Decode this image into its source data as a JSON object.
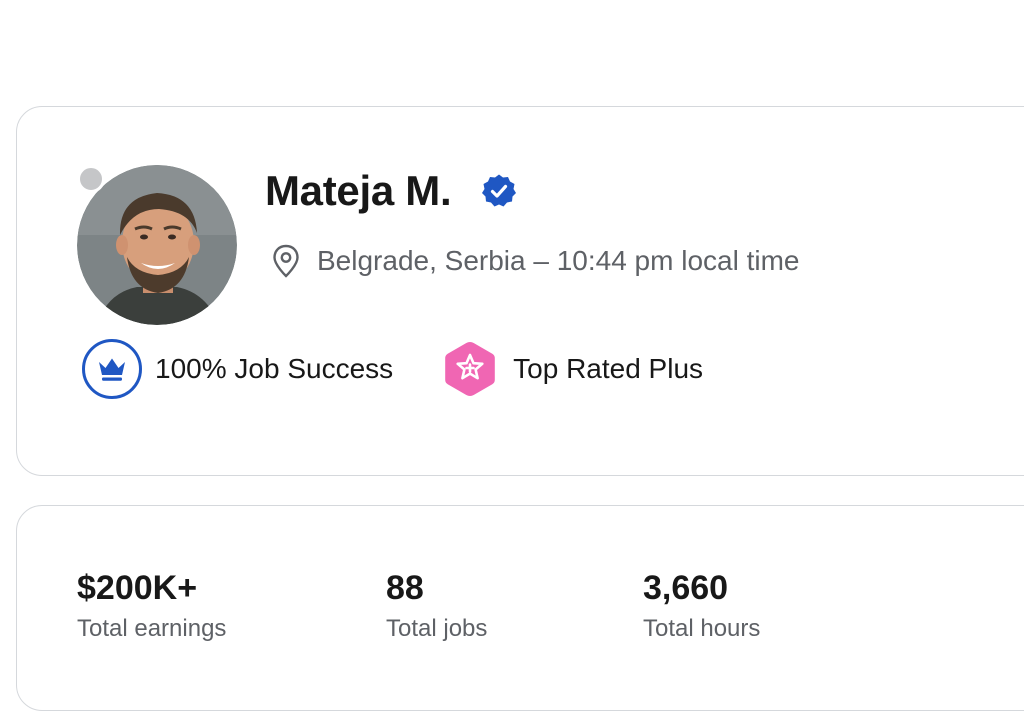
{
  "profile": {
    "name": "Mateja M.",
    "location": "Belgrade, Serbia – 10:44 pm local time",
    "verified_icon": "verified-badge-icon",
    "status": "offline",
    "badges": [
      {
        "label": "100% Job Success",
        "icon": "crown-icon",
        "color": "#1f57c3"
      },
      {
        "label": "Top Rated Plus",
        "icon": "star-plus-icon",
        "color": "#f066b3"
      }
    ]
  },
  "stats": [
    {
      "value": "$200K+",
      "label": "Total earnings"
    },
    {
      "value": "88",
      "label": "Total jobs"
    },
    {
      "value": "3,660",
      "label": "Total hours"
    }
  ],
  "colors": {
    "verified": "#1f57c3",
    "job_success": "#1f57c3",
    "top_rated": "#f066b3",
    "muted_text": "#5e6166",
    "border": "#d5d8dc"
  }
}
